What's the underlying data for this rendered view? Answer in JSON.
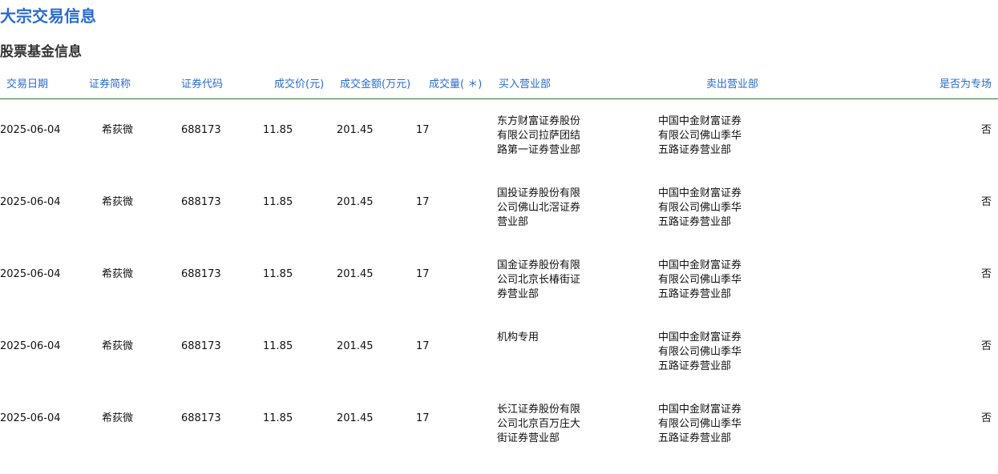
{
  "page": {
    "title": "大宗交易信息",
    "section_title": "股票基金信息"
  },
  "table": {
    "headers": {
      "date": "交易日期",
      "name": "证券简称",
      "code": "证券代码",
      "price": "成交价(元)",
      "amount": "成交金额(万元)",
      "volume": "成交量( ＊)",
      "buyer": "买入营业部",
      "seller": "卖出营业部",
      "special": "是否为专场"
    },
    "rows": [
      {
        "date": "2025-06-04",
        "name": "希荻微",
        "code": "688173",
        "price": "11.85",
        "amount": "201.45",
        "volume": "17",
        "buyer": [
          "东方财富证券股份",
          "有限公司拉萨团结",
          "路第一证券营业部"
        ],
        "seller": [
          "中国中金财富证券",
          "有限公司佛山季华",
          "五路证券营业部"
        ],
        "special": "否"
      },
      {
        "date": "2025-06-04",
        "name": "希荻微",
        "code": "688173",
        "price": "11.85",
        "amount": "201.45",
        "volume": "17",
        "buyer": [
          "国投证券股份有限",
          "公司佛山北滘证券",
          "营业部"
        ],
        "seller": [
          "中国中金财富证券",
          "有限公司佛山季华",
          "五路证券营业部"
        ],
        "special": "否"
      },
      {
        "date": "2025-06-04",
        "name": "希荻微",
        "code": "688173",
        "price": "11.85",
        "amount": "201.45",
        "volume": "17",
        "buyer": [
          "国金证券股份有限",
          "公司北京长椿街证",
          "券营业部"
        ],
        "seller": [
          "中国中金财富证券",
          "有限公司佛山季华",
          "五路证券营业部"
        ],
        "special": "否"
      },
      {
        "date": "2025-06-04",
        "name": "希荻微",
        "code": "688173",
        "price": "11.85",
        "amount": "201.45",
        "volume": "17",
        "buyer": [
          "机构专用",
          "",
          ""
        ],
        "seller": [
          "中国中金财富证券",
          "有限公司佛山季华",
          "五路证券营业部"
        ],
        "special": "否"
      },
      {
        "date": "2025-06-04",
        "name": "希荻微",
        "code": "688173",
        "price": "11.85",
        "amount": "201.45",
        "volume": "17",
        "buyer": [
          "长江证券股份有限",
          "公司北京百万庄大",
          "街证券营业部"
        ],
        "seller": [
          "中国中金财富证券",
          "有限公司佛山季华",
          "五路证券营业部"
        ],
        "special": "否"
      }
    ]
  }
}
